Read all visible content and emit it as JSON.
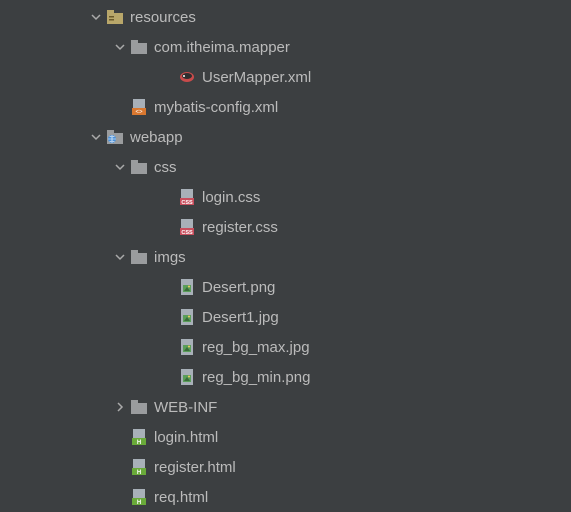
{
  "tree": {
    "resources": {
      "label": "resources",
      "mapper": {
        "label": "com.itheima.mapper",
        "usermapper": "UserMapper.xml"
      },
      "mybatisconfig": "mybatis-config.xml"
    },
    "webapp": {
      "label": "webapp",
      "css": {
        "label": "css",
        "login": "login.css",
        "register": "register.css"
      },
      "imgs": {
        "label": "imgs",
        "desert": "Desert.png",
        "desert1": "Desert1.jpg",
        "regbgmax": "reg_bg_max.jpg",
        "regbgmin": "reg_bg_min.png"
      },
      "webinf": "WEB-INF",
      "loginhtml": "login.html",
      "registerhtml": "register.html",
      "reqhtml": "req.html"
    }
  }
}
